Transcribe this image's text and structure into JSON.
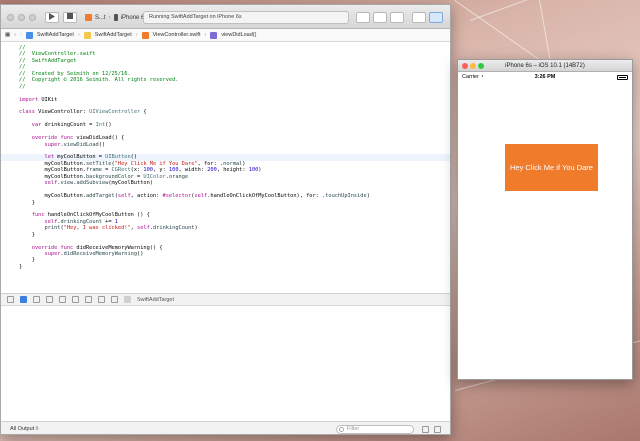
{
  "xcode": {
    "toolbar": {
      "scheme_target": "S...t",
      "scheme_device": "iPhone 6s",
      "status_text": "Running SwiftAddTarget on iPhone 6s"
    },
    "jumpbar": {
      "crumbs": [
        "SwiftAddTarget",
        "SwiftAddTarget",
        "ViewController.swift",
        "viewDidLoad()"
      ]
    },
    "code_lines": [
      [
        [
          "comment",
          "//"
        ]
      ],
      [
        [
          "comment",
          "//  ViewController.swift"
        ]
      ],
      [
        [
          "comment",
          "//  SwiftAddTarget"
        ]
      ],
      [
        [
          "comment",
          "//"
        ]
      ],
      [
        [
          "comment",
          "//  Created by Seimith on 12/25/16."
        ]
      ],
      [
        [
          "comment",
          "//  Copyright © 2016 Seimith. All rights reserved."
        ]
      ],
      [
        [
          "comment",
          "//"
        ]
      ],
      [],
      [
        [
          "keyword",
          "import"
        ],
        [
          "plain",
          " UIKit"
        ]
      ],
      [],
      [
        [
          "keyword",
          "class"
        ],
        [
          "plain",
          " ViewController: "
        ],
        [
          "type",
          "UIViewController"
        ],
        [
          "plain",
          " {"
        ]
      ],
      [],
      [
        [
          "plain",
          "    "
        ],
        [
          "keyword",
          "var"
        ],
        [
          "plain",
          " drinkingCount = "
        ],
        [
          "type",
          "Int"
        ],
        [
          "plain",
          "()"
        ]
      ],
      [],
      [
        [
          "plain",
          "    "
        ],
        [
          "keyword",
          "override func"
        ],
        [
          "plain",
          " viewDidLoad() {"
        ]
      ],
      [
        [
          "plain",
          "        "
        ],
        [
          "keyword",
          "super"
        ],
        [
          "plain",
          "."
        ],
        [
          "call",
          "viewDidLoad"
        ],
        [
          "plain",
          "()"
        ]
      ],
      [],
      [
        [
          "plain",
          "        "
        ],
        [
          "keyword",
          "let"
        ],
        [
          "plain",
          " myCoolButton = "
        ],
        [
          "type",
          "UIButton"
        ],
        [
          "plain",
          "()"
        ]
      ],
      [
        [
          "plain",
          "        myCoolButton."
        ],
        [
          "call",
          "setTitle"
        ],
        [
          "plain",
          "("
        ],
        [
          "string",
          "\"Hey Click Me if You Dare\""
        ],
        [
          "plain",
          ", for: ."
        ],
        [
          "call",
          "normal"
        ],
        [
          "plain",
          ")"
        ]
      ],
      [
        [
          "plain",
          "        myCoolButton."
        ],
        [
          "call",
          "frame"
        ],
        [
          "plain",
          " = "
        ],
        [
          "type",
          "CGRect"
        ],
        [
          "plain",
          "(x: "
        ],
        [
          "number",
          "100"
        ],
        [
          "plain",
          ", y: "
        ],
        [
          "number",
          "100"
        ],
        [
          "plain",
          ", width: "
        ],
        [
          "number",
          "200"
        ],
        [
          "plain",
          ", height: "
        ],
        [
          "number",
          "100"
        ],
        [
          "plain",
          ")"
        ]
      ],
      [
        [
          "plain",
          "        myCoolButton."
        ],
        [
          "call",
          "backgroundColor"
        ],
        [
          "plain",
          " = "
        ],
        [
          "type",
          "UIColor"
        ],
        [
          "plain",
          "."
        ],
        [
          "call",
          "orange"
        ]
      ],
      [
        [
          "plain",
          "        "
        ],
        [
          "keyword",
          "self"
        ],
        [
          "plain",
          "."
        ],
        [
          "call",
          "view"
        ],
        [
          "plain",
          "."
        ],
        [
          "call",
          "addSubview"
        ],
        [
          "plain",
          "(myCoolButton)"
        ]
      ],
      [],
      [
        [
          "plain",
          "        myCoolButton."
        ],
        [
          "call",
          "addTarget"
        ],
        [
          "plain",
          "("
        ],
        [
          "keyword",
          "self"
        ],
        [
          "plain",
          ", action: "
        ],
        [
          "keyword",
          "#selector"
        ],
        [
          "plain",
          "("
        ],
        [
          "keyword",
          "self"
        ],
        [
          "plain",
          ".handleOnClickOfMyCoolButton), for: ."
        ],
        [
          "call",
          "touchUpInside"
        ],
        [
          "plain",
          ")"
        ]
      ],
      [
        [
          "plain",
          "    }"
        ]
      ],
      [],
      [
        [
          "plain",
          "    "
        ],
        [
          "keyword",
          "func"
        ],
        [
          "plain",
          " handleOnClickOfMyCoolButton () {"
        ]
      ],
      [
        [
          "plain",
          "        "
        ],
        [
          "keyword",
          "self"
        ],
        [
          "plain",
          "."
        ],
        [
          "call",
          "drinkingCount"
        ],
        [
          "plain",
          " += "
        ],
        [
          "number",
          "1"
        ]
      ],
      [
        [
          "plain",
          "        "
        ],
        [
          "call",
          "print"
        ],
        [
          "plain",
          "("
        ],
        [
          "string",
          "\"Hey, I was clicked!\""
        ],
        [
          "plain",
          ", "
        ],
        [
          "keyword",
          "self"
        ],
        [
          "plain",
          "."
        ],
        [
          "call",
          "drinkingCount"
        ],
        [
          "plain",
          ")"
        ]
      ],
      [
        [
          "plain",
          "    }"
        ]
      ],
      [],
      [
        [
          "plain",
          "    "
        ],
        [
          "keyword",
          "override func"
        ],
        [
          "plain",
          " didReceiveMemoryWarning() {"
        ]
      ],
      [
        [
          "plain",
          "        "
        ],
        [
          "keyword",
          "super"
        ],
        [
          "plain",
          "."
        ],
        [
          "call",
          "didReceiveMemoryWarning"
        ],
        [
          "plain",
          "()"
        ]
      ],
      [
        [
          "plain",
          "    }"
        ]
      ],
      [
        [
          "plain",
          "}"
        ]
      ]
    ],
    "current_line_index": 17,
    "debug_bar": {
      "process_label": "SwiftAddTarget"
    },
    "bottom_bar": {
      "output_selector": "All Output ◊",
      "filter_placeholder": "Filter"
    }
  },
  "simulator": {
    "window_title": "iPhone 6s – iOS 10.1 (14B72)",
    "status_bar": {
      "carrier": "Carrier",
      "time": "3:26 PM"
    },
    "button": {
      "label": "Hey Click Me if You Dare",
      "color": "#f07b2b"
    }
  },
  "colors": {
    "comment": "#008312",
    "keyword": "#aa0d91",
    "type": "#3f6e74",
    "string": "#c41a16",
    "number": "#1c00cf",
    "accent_blue": "#3b7fe0"
  }
}
